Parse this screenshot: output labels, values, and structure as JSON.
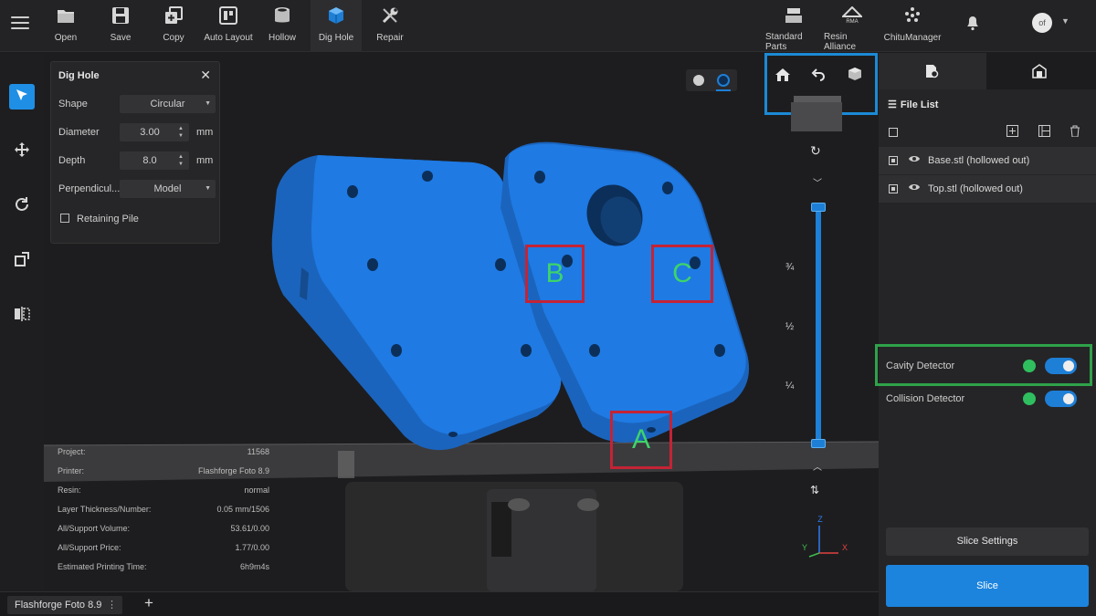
{
  "toolbar": {
    "items": [
      {
        "label": "Open",
        "icon": "folder-icon"
      },
      {
        "label": "Save",
        "icon": "floppy-disk-icon"
      },
      {
        "label": "Copy",
        "icon": "copy-plus-icon"
      },
      {
        "label": "Auto Layout",
        "icon": "auto-layout-icon"
      },
      {
        "label": "Hollow",
        "icon": "cylinder-icon"
      },
      {
        "label": "Dig Hole",
        "icon": "cube-icon"
      },
      {
        "label": "Repair",
        "icon": "wrench-icon"
      }
    ],
    "right_items": [
      {
        "label": "Standard Parts",
        "icon": "parts-icon"
      },
      {
        "label": "Resin Alliance",
        "icon": "rma-icon"
      },
      {
        "label": "ChituManager",
        "icon": "chitu-icon"
      }
    ],
    "avatar_text": "of"
  },
  "dig_hole": {
    "title": "Dig Hole",
    "shape_label": "Shape",
    "shape_value": "Circular",
    "diameter_label": "Diameter",
    "diameter_value": "3.00",
    "depth_label": "Depth",
    "depth_value": "8.0",
    "unit": "mm",
    "perpendicular_label": "Perpendicul...",
    "perpendicular_value": "Model",
    "retaining_label": "Retaining Pile"
  },
  "project_info": [
    {
      "key": "Project:",
      "value": "11568"
    },
    {
      "key": "Printer:",
      "value": "Flashforge Foto 8.9"
    },
    {
      "key": "Resin:",
      "value": "normal"
    },
    {
      "key": "Layer Thickness/Number:",
      "value": "0.05 mm/1506"
    },
    {
      "key": "All/Support Volume:",
      "value": "53.61/0.00"
    },
    {
      "key": "All/Support Price:",
      "value": "1.77/0.00"
    },
    {
      "key": "Estimated Printing Time:",
      "value": "6h9m4s"
    }
  ],
  "markers": {
    "a": "A",
    "b": "B",
    "c": "C"
  },
  "slider_fractions": [
    "¾",
    "½",
    "¼"
  ],
  "axes": {
    "z": "Z",
    "y": "Y",
    "x": "X"
  },
  "right_panel": {
    "file_list_title": "File List",
    "files": [
      "Base.stl (hollowed out)",
      "Top.stl (hollowed out)"
    ],
    "cavity_detector": "Cavity Detector",
    "collision_detector": "Collision Detector",
    "slice_settings": "Slice Settings",
    "slice": "Slice"
  },
  "bottom": {
    "printer_tab": "Flashforge Foto 8.9"
  },
  "colors": {
    "accent": "#1e7fd6",
    "model": "#1f78e0",
    "highlight_red": "#c42335",
    "highlight_blue": "#1b8ad6",
    "highlight_green": "#2fa24a",
    "marker_text": "#3dd46a"
  }
}
